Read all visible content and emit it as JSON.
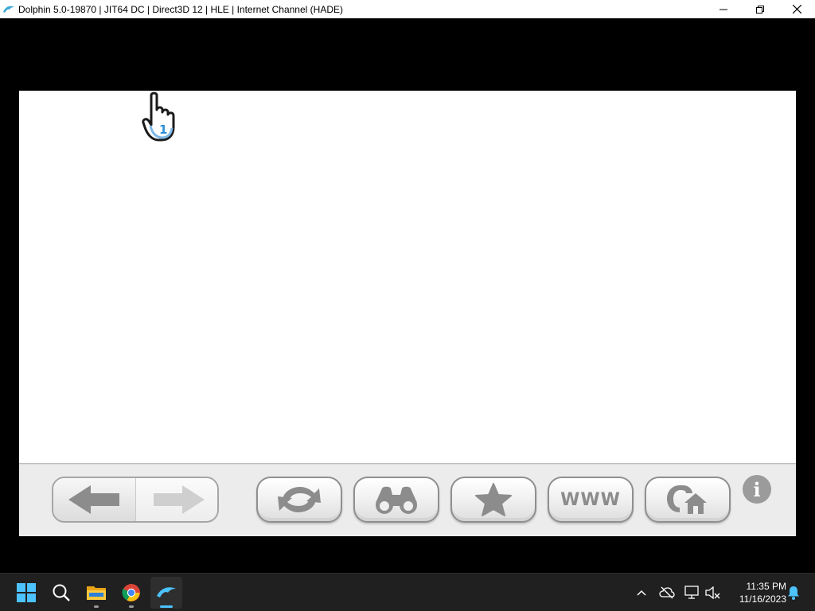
{
  "window": {
    "title": "Dolphin 5.0-19870 | JIT64 DC | Direct3D 12 | HLE | Internet Channel (HADE)",
    "controls": [
      "minimize-icon",
      "restore-icon",
      "close-icon"
    ]
  },
  "internet_channel": {
    "cursor": {
      "player_number": "1",
      "icon": "wii-hand-pointer-icon"
    },
    "toolbar": {
      "back_icon": "arrow-left-icon",
      "forward_icon": "arrow-right-icon",
      "reload_icon": "reload-icon",
      "search_icon": "binoculars-icon",
      "favorites_icon": "star-icon",
      "www_label": "WWW",
      "home_icon": "home-icon",
      "info_label": "i"
    }
  },
  "taskbar": {
    "apps": [
      {
        "name": "start",
        "icon": "windows-start-icon"
      },
      {
        "name": "search",
        "icon": "search-icon"
      },
      {
        "name": "file-explorer",
        "icon": "folder-icon"
      },
      {
        "name": "chrome",
        "icon": "chrome-icon"
      },
      {
        "name": "dolphin",
        "icon": "dolphin-icon",
        "active": true
      }
    ],
    "tray": [
      "chevron-up-icon",
      "cloud-off-icon",
      "network-icon",
      "volume-muted-icon",
      "notification-bell-icon"
    ],
    "clock": {
      "time": "11:35 PM",
      "date": "11/16/2023"
    }
  },
  "colors": {
    "taskbar_bg": "#202020",
    "accent": "#4cc2ff",
    "toolbar_bg": "#ececec",
    "button_glyph": "#8c8c8c"
  }
}
